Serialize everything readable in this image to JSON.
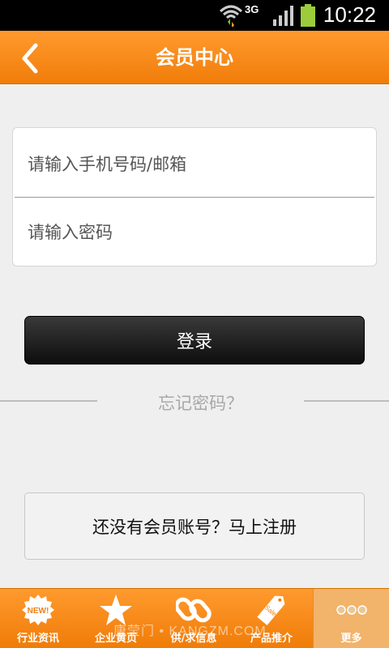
{
  "status_bar": {
    "network": "3G",
    "time": "10:22",
    "icons": [
      "wifi-icon",
      "signal-icon",
      "battery-icon"
    ]
  },
  "header": {
    "title": "会员中心",
    "back_icon": "chevron-left-icon"
  },
  "login_form": {
    "account_placeholder": "请输入手机号码/邮箱",
    "password_placeholder": "请输入密码",
    "login_label": "登录",
    "forgot_label": "忘记密码？",
    "register_label": "还没有会员账号？马上注册"
  },
  "bottom_nav": {
    "items": [
      {
        "label": "行业资讯",
        "icon": "new-badge-icon"
      },
      {
        "label": "企业黄页",
        "icon": "star-icon"
      },
      {
        "label": "供/求信息",
        "icon": "link-icon"
      },
      {
        "label": "产品推介",
        "icon": "sale-tag-icon"
      },
      {
        "label": "更多",
        "icon": "more-dots-icon"
      }
    ],
    "active_index": 4,
    "watermark": "康莹门 • KANGZM.COM"
  },
  "colors": {
    "accent": "#f58a1a",
    "button_dark": "#1a1a1a",
    "background": "#efefef"
  }
}
